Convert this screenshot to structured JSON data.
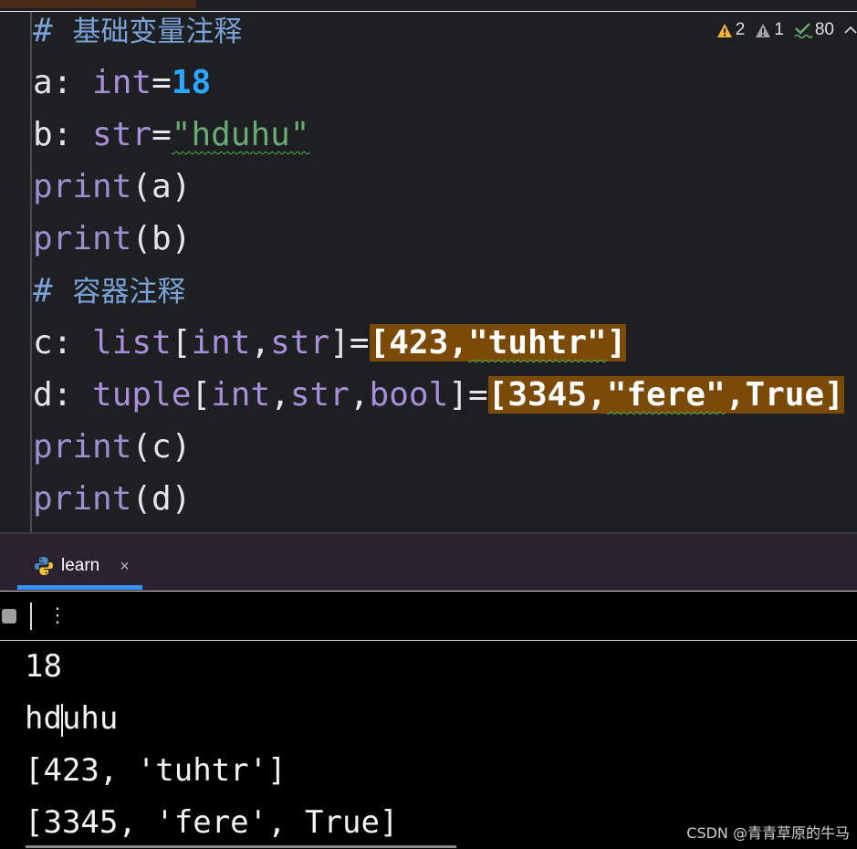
{
  "editor": {
    "lines": {
      "l1": {
        "comment": "#",
        "text": "基础变量注释"
      },
      "l2": {
        "name": "a:",
        "type": "int",
        "eq": "=",
        "value": "18"
      },
      "l3": {
        "name": "b:",
        "type": "str",
        "eq": "=",
        "value": "\"hduhu\""
      },
      "l4": {
        "fn": "print",
        "args": "(a)"
      },
      "l5": {
        "fn": "print",
        "args": "(b)"
      },
      "l6": {
        "comment": "#",
        "text": "容器注释"
      },
      "l7": {
        "name": "c:",
        "type": "list",
        "ob": "[",
        "t1": "int",
        "comma": ",",
        "t2": "str",
        "cb": "]",
        "eq": "=",
        "h_open": "[",
        "h_num": "423",
        "h_comma": ",",
        "h_str": "\"tuhtr\"",
        "h_close": "]"
      },
      "l8": {
        "name": "d:",
        "type": "tuple",
        "ob": "[",
        "t1": "int",
        "comma1": ",",
        "t2": "str",
        "comma2": ",",
        "t3": "bool",
        "cb": "]",
        "eq": "=",
        "h_open": "[",
        "h_num": "3345",
        "h_comma1": ",",
        "h_str": "\"fere\"",
        "h_comma2": ",",
        "h_bool": "True",
        "h_close": "]"
      },
      "l9": {
        "fn": "print",
        "args": "(c)"
      },
      "l10": {
        "fn": "print",
        "args": "(d)"
      }
    },
    "inspections": {
      "warnings": "2",
      "weak_warnings": "1",
      "typos": "80"
    }
  },
  "run_panel": {
    "tab_label": "learn",
    "close_glyph": "×",
    "more_glyph": "⋮"
  },
  "console": {
    "lines": [
      "18",
      "hduhu",
      "[423, 'tuhtr']",
      "[3345, 'fere', True]"
    ],
    "caret_split": [
      "hd",
      "uhu"
    ]
  },
  "watermark": "CSDN @青青草原的牛马",
  "colors": {
    "editor_bg": "#1e1f22",
    "highlight": "#7a4a06",
    "number": "#2aa7ff",
    "string": "#6aab73",
    "tab_accent": "#3592ff"
  }
}
